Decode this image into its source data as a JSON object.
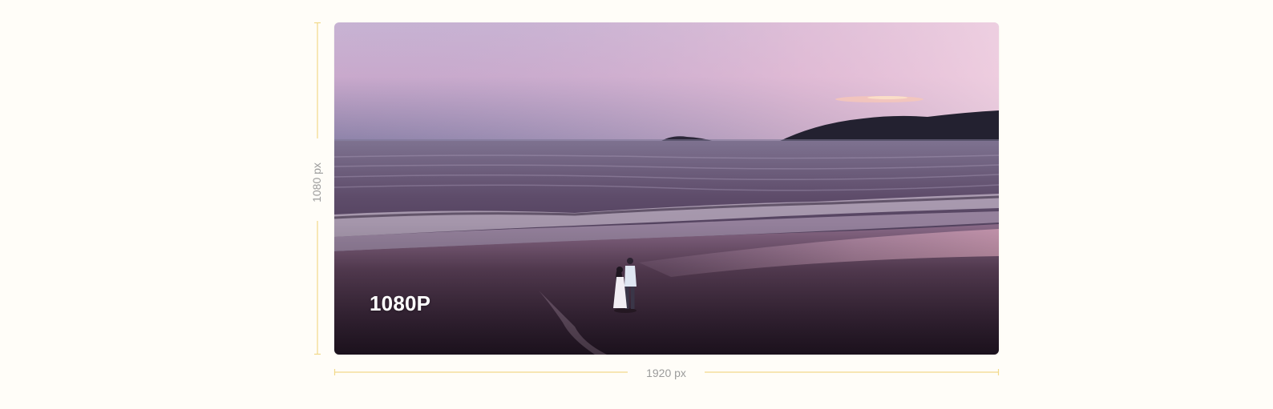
{
  "image": {
    "overlay_label": "1080P",
    "scene": "beach-sunset-couple-photo"
  },
  "dimensions": {
    "height_label": "1080 px",
    "width_label": "1920 px"
  },
  "colors": {
    "background": "#fffdf8",
    "ruler": "#f2d98a",
    "ruler_text": "#9b9b9b"
  }
}
